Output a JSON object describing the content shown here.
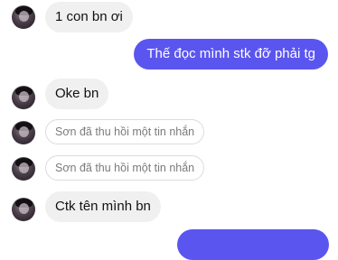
{
  "messages": [
    {
      "text": "1 con bn ơi"
    },
    {
      "text": "Thế đọc mình stk đỡ phải tg"
    },
    {
      "text": "Oke bn"
    },
    {
      "text": "Sơn đã thu hồi một tin nhắn"
    },
    {
      "text": "Sơn đã thu hồi một tin nhắn"
    },
    {
      "text": "Ctk tên mình bn"
    }
  ],
  "colors": {
    "outgoing_bubble": "#5b55f0",
    "incoming_bubble": "#f0f0f0"
  }
}
